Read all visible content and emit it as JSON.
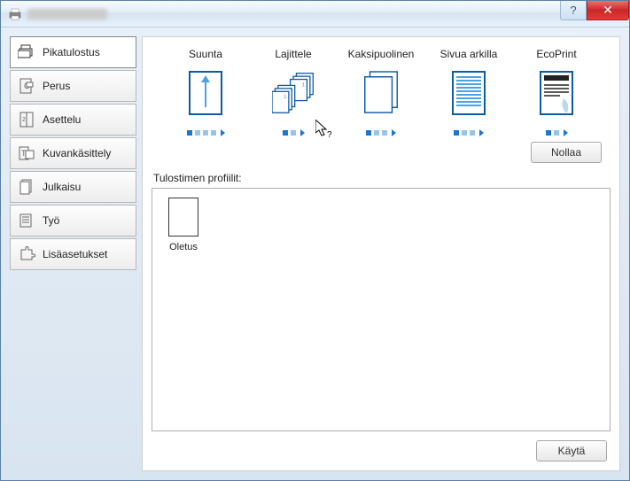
{
  "titlebar": {
    "help_char": "?",
    "close_char": "✕"
  },
  "sidebar": {
    "items": [
      {
        "label": "Pikatulostus",
        "icon": "printer-stack"
      },
      {
        "label": "Perus",
        "icon": "page-c"
      },
      {
        "label": "Asettelu",
        "icon": "layout"
      },
      {
        "label": "Kuvankäsittely",
        "icon": "image-t"
      },
      {
        "label": "Julkaisu",
        "icon": "pages"
      },
      {
        "label": "Työ",
        "icon": "job"
      },
      {
        "label": "Lisäasetukset",
        "icon": "puzzle"
      }
    ]
  },
  "options": [
    {
      "label": "Suunta",
      "dots": 4,
      "active": 0
    },
    {
      "label": "Lajittele",
      "dots": 2,
      "active": 0
    },
    {
      "label": "Kaksipuolinen",
      "dots": 3,
      "active": 0
    },
    {
      "label": "Sivua arkilla",
      "dots": 3,
      "active": 0
    },
    {
      "label": "EcoPrint",
      "dots": 2,
      "active": 0
    }
  ],
  "buttons": {
    "reset": "Nollaa",
    "apply": "Käytä"
  },
  "profiles": {
    "label": "Tulostimen profiilit:",
    "items": [
      {
        "name": "Oletus"
      }
    ]
  }
}
